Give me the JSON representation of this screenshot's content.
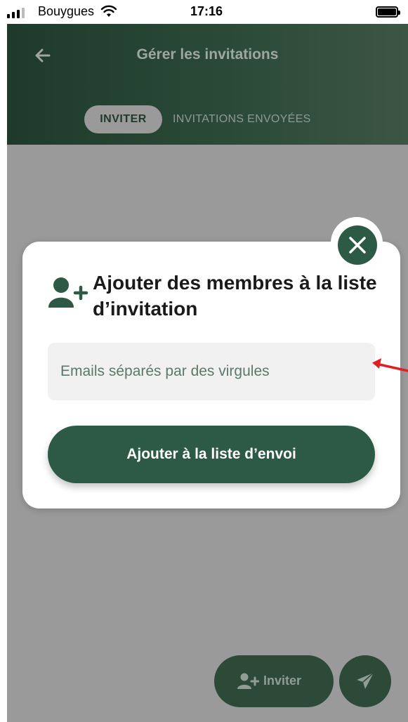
{
  "status_bar": {
    "carrier": "Bouygues",
    "time": "17:16",
    "icons": [
      "signal-bars-icon",
      "wifi-icon",
      "battery-icon"
    ]
  },
  "header": {
    "title": "Gérer les invitations",
    "back_icon": "arrow-left-icon",
    "tabs": [
      {
        "label": "INVITER",
        "active": true
      },
      {
        "label": "INVITATIONS ENVOYÉES",
        "active": false
      }
    ]
  },
  "modal": {
    "title": "Ajouter des membres à la liste d’invitation",
    "title_icon": "user-plus-icon",
    "close_icon": "close-icon",
    "email_field": {
      "value": "",
      "placeholder": "Emails séparés par des virgules"
    },
    "submit_label": "Ajouter à la liste d’envoi"
  },
  "fab": {
    "invite_label": "Inviter",
    "invite_icon": "user-plus-icon",
    "send_icon": "paper-plane-icon"
  },
  "annotation": {
    "type": "red-arrow",
    "color": "#e02020"
  },
  "colors": {
    "header_dark": "#1f3a2b",
    "primary_green": "#2d5a45",
    "overlay_gray": "#9a9a9a",
    "input_bg": "#f1f1f1",
    "placeholder_green": "#5d7868"
  }
}
